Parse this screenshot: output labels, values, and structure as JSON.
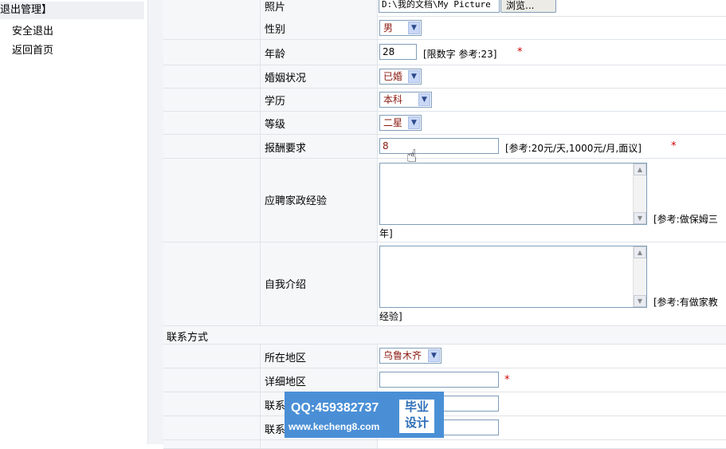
{
  "sidebar": {
    "header": "退出管理】",
    "items": [
      {
        "label": "安全退出"
      },
      {
        "label": "返回首页"
      }
    ]
  },
  "form": {
    "photo": {
      "label": "照片",
      "value": "D:\\我的文档\\My Picture",
      "browse": "浏览..."
    },
    "gender": {
      "label": "性别",
      "value": "男"
    },
    "age": {
      "label": "年龄",
      "value": "28",
      "hint": "[限数字 参考:23]"
    },
    "marital": {
      "label": "婚姻状况",
      "value": "已婚"
    },
    "education": {
      "label": "学历",
      "value": "本科"
    },
    "grade": {
      "label": "等级",
      "value": "二星"
    },
    "salary": {
      "label": "报酬要求",
      "value": "8",
      "hint": "[参考:20元/天,1000元/月,面议]"
    },
    "experience": {
      "label": "应聘家政经验",
      "hint": "[参考:做保姆三",
      "hint_wrap": "年]"
    },
    "intro": {
      "label": "自我介绍",
      "hint": "[参考:有做家教",
      "hint_wrap": "经验]"
    },
    "contact_section": "联系方式",
    "region": {
      "label": "所在地区",
      "value": "乌鲁木齐"
    },
    "address": {
      "label": "详细地区"
    },
    "contact1": {
      "label": "联系"
    },
    "contact2": {
      "label": "联系"
    },
    "required_mark": "*"
  },
  "watermark": {
    "qq": "QQ:459382737",
    "url": "www.kecheng8.com",
    "badge_line1": "毕业",
    "badge_line2": "设计"
  }
}
